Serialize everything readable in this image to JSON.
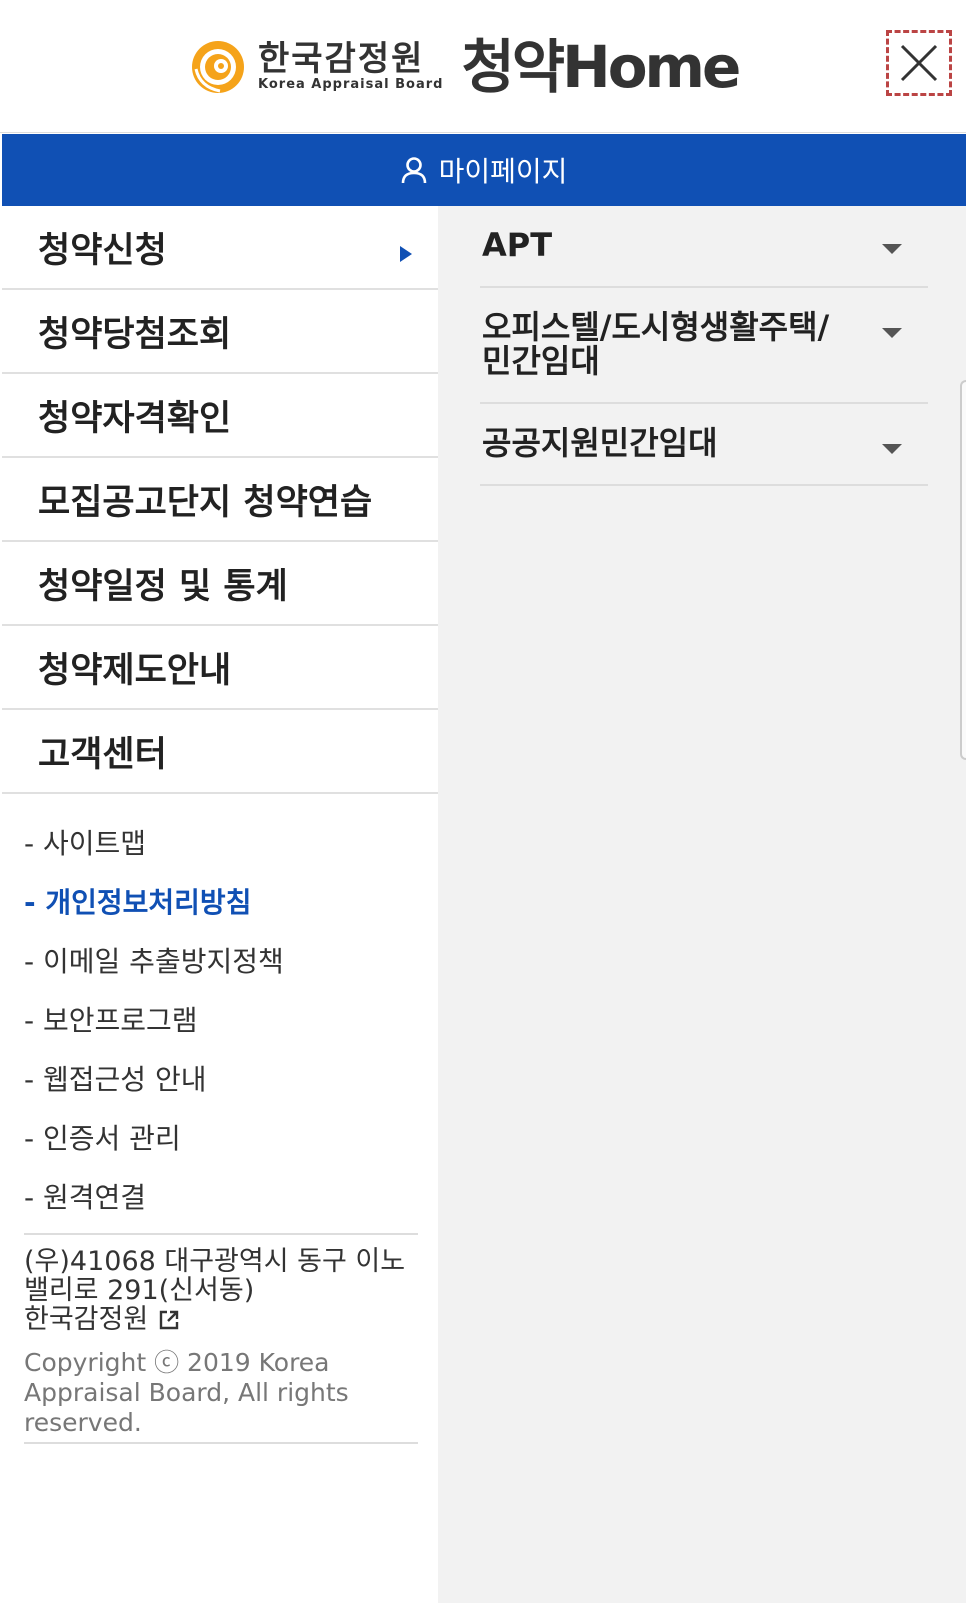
{
  "header": {
    "org_name_kr": "한국감정원",
    "org_name_en": "Korea Appraisal Board",
    "service_name": "청약Home",
    "close_label": "닫기",
    "logo_color": "#f5a31a"
  },
  "mypage": {
    "label": "마이페이지",
    "icon": "person-icon",
    "bg_color": "#1050b4"
  },
  "menu": {
    "items": [
      {
        "label": "청약신청",
        "active": true
      },
      {
        "label": "청약당첨조회"
      },
      {
        "label": "청약자격확인"
      },
      {
        "label": "모집공고단지 청약연습"
      },
      {
        "label": "청약일정 및 통계"
      },
      {
        "label": "청약제도안내"
      },
      {
        "label": "고객센터"
      }
    ]
  },
  "submenu": {
    "items": [
      {
        "label": "APT"
      },
      {
        "label": "오피스텔/도시형생활주택/민간임대"
      },
      {
        "label": "공공지원민간임대"
      }
    ]
  },
  "links": {
    "items": [
      {
        "label": "- 사이트맵"
      },
      {
        "label": "- 개인정보처리방침",
        "highlight": true
      },
      {
        "label": "- 이메일 추출방지정책"
      },
      {
        "label": "- 보안프로그램"
      },
      {
        "label": "- 웹접근성 안내"
      },
      {
        "label": "- 인증서 관리"
      },
      {
        "label": "- 원격연결"
      }
    ]
  },
  "footer": {
    "address": "(우)41068 대구광역시 동구 이노밸리로 291(신서동)",
    "org": "한국감정원",
    "copyright": "Copyright ⓒ 2019 Korea Appraisal Board, All rights reserved."
  }
}
